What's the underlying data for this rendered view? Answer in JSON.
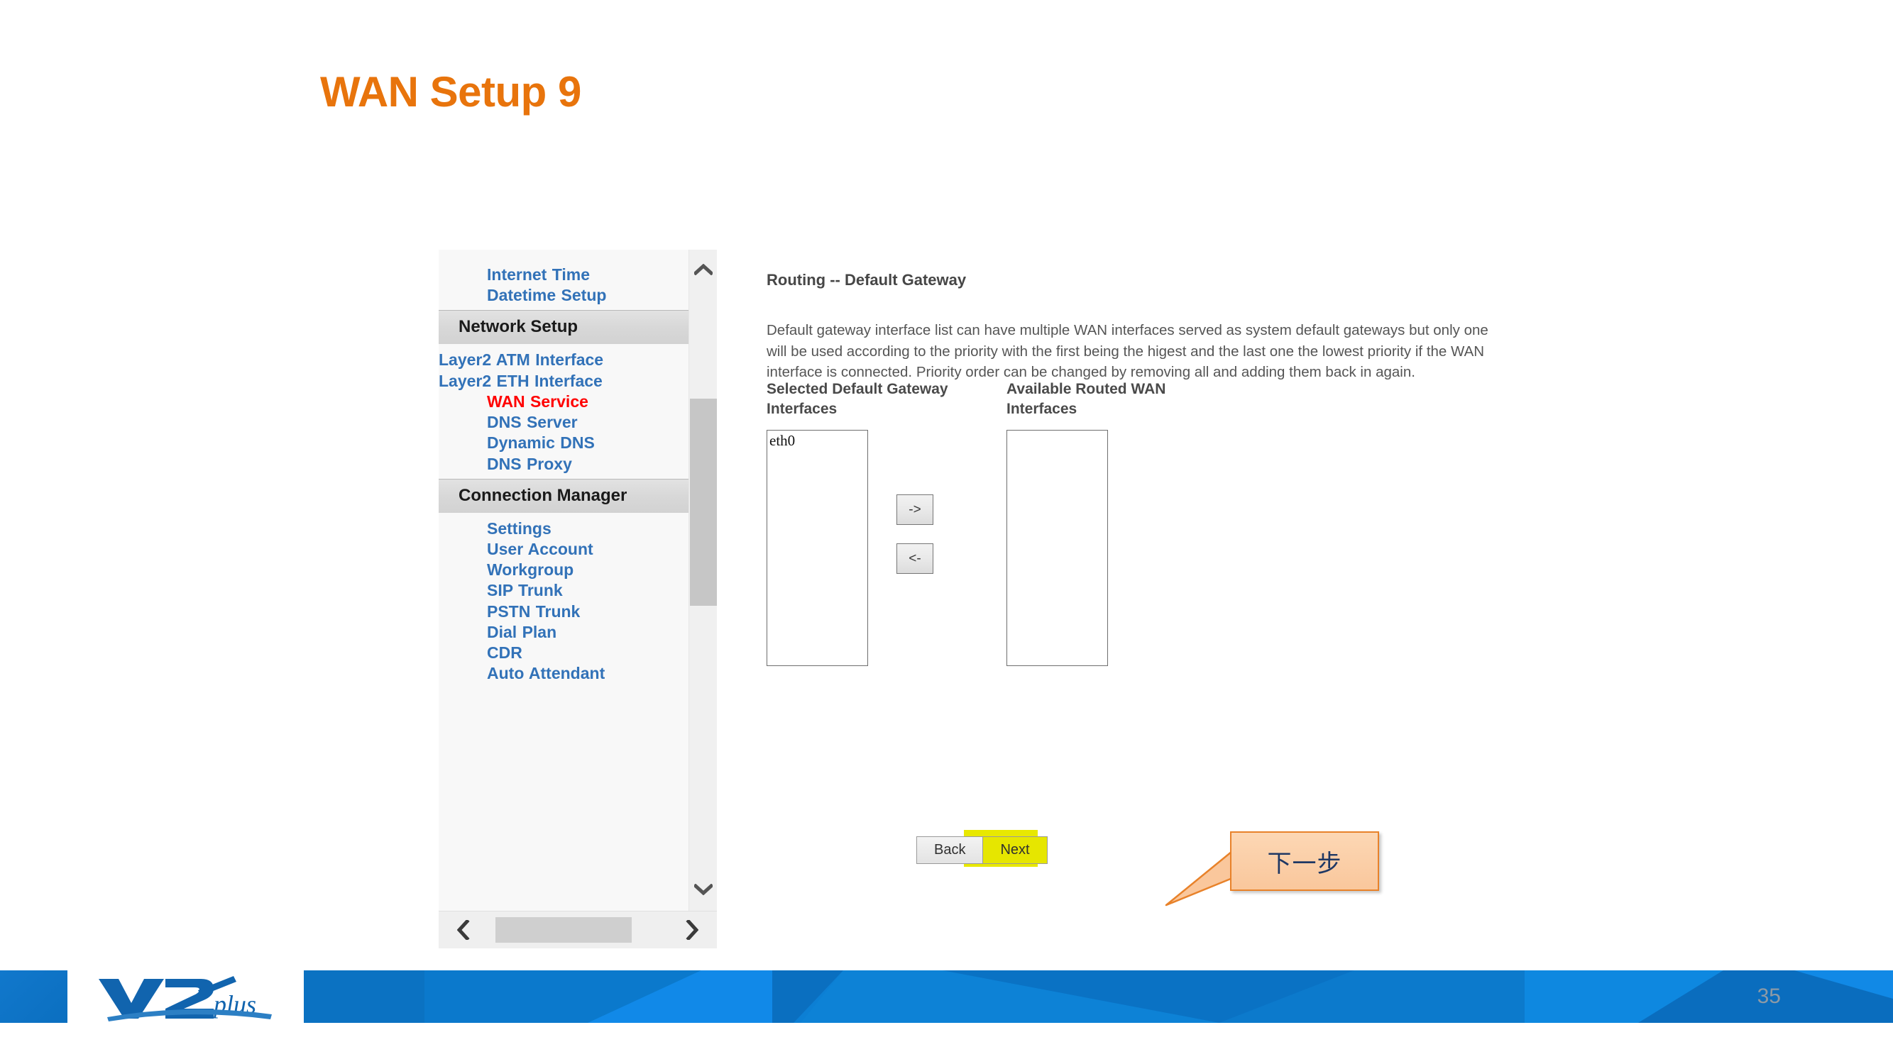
{
  "slide": {
    "title": "WAN Setup 9",
    "page_number": "35",
    "title_color": "#E8740C"
  },
  "sidebar": {
    "top_items": [
      {
        "label": "Internet Time",
        "type": "link",
        "active": false
      },
      {
        "label": "Datetime Setup",
        "type": "link",
        "active": false
      }
    ],
    "groups": [
      {
        "header": "Network Setup",
        "items": [
          {
            "label": "Layer2 ATM Interface",
            "type": "link",
            "active": false,
            "wraps": true
          },
          {
            "label": "Layer2 ETH Interface",
            "type": "link",
            "active": false,
            "wraps": true
          },
          {
            "label": "WAN Service",
            "type": "link",
            "active": true,
            "wraps": false
          },
          {
            "label": "DNS Server",
            "type": "link",
            "active": false,
            "wraps": false
          },
          {
            "label": "Dynamic DNS",
            "type": "link",
            "active": false,
            "wraps": false
          },
          {
            "label": "DNS Proxy",
            "type": "link",
            "active": false,
            "wraps": false
          }
        ]
      },
      {
        "header": "Connection Manager",
        "items": [
          {
            "label": "Settings",
            "type": "link",
            "active": false,
            "wraps": false
          },
          {
            "label": "User Account",
            "type": "link",
            "active": false,
            "wraps": false
          },
          {
            "label": "Workgroup",
            "type": "link",
            "active": false,
            "wraps": false
          },
          {
            "label": "SIP Trunk",
            "type": "link",
            "active": false,
            "wraps": false
          },
          {
            "label": "PSTN Trunk",
            "type": "link",
            "active": false,
            "wraps": false
          },
          {
            "label": "Dial Plan",
            "type": "link",
            "active": false,
            "wraps": false
          },
          {
            "label": "CDR",
            "type": "link",
            "active": false,
            "wraps": false
          },
          {
            "label": "Auto Attendant",
            "type": "link",
            "active": false,
            "wraps": false
          }
        ]
      }
    ],
    "active_color": "#FF0000",
    "link_color": "#3272B8"
  },
  "main": {
    "heading": "Routing -- Default Gateway",
    "description": "Default gateway interface list can have multiple WAN interfaces served as system default gateways but only one will be used according to the priority with the first being the higest and the last one the lowest priority if the WAN interface is connected. Priority order can be changed by removing all and adding them back in again.",
    "selected_label": "Selected Default Gateway Interfaces",
    "available_label": "Available Routed WAN Interfaces",
    "selected_items": [
      "eth0"
    ],
    "available_items": [],
    "add_button": "->",
    "remove_button": "<-",
    "back_button": "Back",
    "next_button": "Next"
  },
  "callout": {
    "text": "下一步",
    "fill_color": "#FAC79C",
    "border_color": "#E8822A",
    "text_color": "#1F3864"
  },
  "footer": {
    "logo_text_main": "V2",
    "logo_text_script": "plus",
    "brand_color": "#0B6FC0"
  }
}
